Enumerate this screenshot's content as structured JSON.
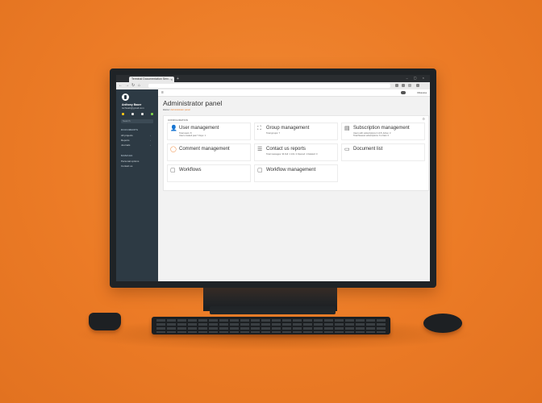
{
  "browser": {
    "tab_title": "Terminal Documentation Serv...",
    "tab_close": "×",
    "new_tab": "+",
    "window_controls": "– ▢ ×",
    "back": "←",
    "forward": "→",
    "reload": "↻",
    "home": "⌂"
  },
  "sidebar": {
    "user_name": "Anthony Bauer",
    "user_email": "tschwab@gmail.com",
    "search_placeholder": "Search",
    "section_documents": "DOCUMENTS",
    "items_documents": [
      {
        "label": "All projects"
      },
      {
        "label": "Reports"
      },
      {
        "label": "Journals"
      }
    ],
    "section_manage": "MANAGE",
    "items_manage": [
      {
        "label": "Personal options"
      },
      {
        "label": "Contact us"
      }
    ],
    "icon_colors": [
      "#f5c518",
      "#e2e2e2",
      "#e2e2e2",
      "#7ccf4a"
    ]
  },
  "topbar": {
    "menu_icon": "≡",
    "user_label": "Rikastoa"
  },
  "page": {
    "title": "Administrator panel",
    "breadcrumb_home": "Home",
    "breadcrumb_sep": "/",
    "breadcrumb_current": "Administrator panel"
  },
  "panel": {
    "heading": "CONFIGURATION",
    "gear": "⚙",
    "cards": [
      {
        "title": "User management",
        "icon": "user-icon",
        "glyph": "👤",
        "sub1": "Total users: 8",
        "sub2": "Users created past 7 days: 1"
      },
      {
        "title": "Group management",
        "icon": "group-icon",
        "glyph": "⛶",
        "sub1": "Total groups: 7",
        "sub2": ""
      },
      {
        "title": "Subscription management",
        "icon": "subscription-icon",
        "glyph": "▤",
        "sub1": "Users with subscriptions 3 of 8: Active: 3",
        "sub2": "Total Newest subscriptions: 6 of last: 0"
      },
      {
        "title": "Comment management",
        "icon": "comment-icon",
        "glyph": "◯",
        "sub1": "",
        "sub2": ""
      },
      {
        "title": "Contact us reports",
        "icon": "report-icon",
        "glyph": "☰",
        "sub1": "Total messages: 34 Full: 1 Info: 2 Opened: 1 Deleted: 0",
        "sub2": ""
      },
      {
        "title": "Document list",
        "icon": "document-list-icon",
        "glyph": "▭",
        "sub1": "",
        "sub2": ""
      },
      {
        "title": "Workflows",
        "icon": "workflow-icon",
        "glyph": "▢",
        "sub1": "",
        "sub2": ""
      },
      {
        "title": "Workflow management",
        "icon": "workflow-management-icon",
        "glyph": "▢",
        "sub1": "",
        "sub2": ""
      }
    ]
  },
  "colors": {
    "background": "#ee7f2a",
    "sidebar": "#2d3a44",
    "accent": "#ee7f2a"
  }
}
